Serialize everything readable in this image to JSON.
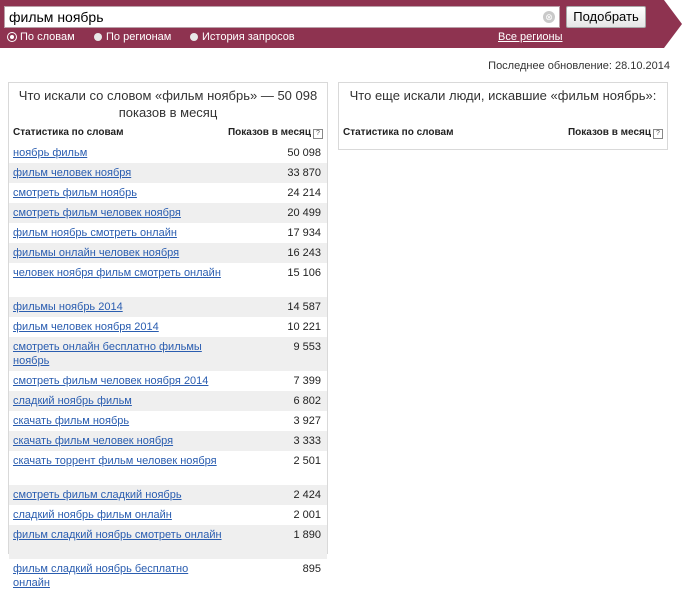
{
  "search": {
    "query": "фильм ноябрь",
    "clear_glyph": "⊗",
    "submit_label": "Подобрать"
  },
  "mode_tabs": [
    {
      "label": "По словам",
      "selected": true
    },
    {
      "label": "По регионам",
      "selected": false
    },
    {
      "label": "История запросов",
      "selected": false
    }
  ],
  "all_regions_label": "Все регионы",
  "last_update": "Последнее обновление: 28.10.2014",
  "left_panel": {
    "title": "Что искали со словом «фильм ноябрь» — 50 098 показов в месяц",
    "col_words": "Статистика по словам",
    "col_shows": "Показов в месяц",
    "help_glyph": "?",
    "rows": [
      {
        "q": "ноябрь фильм",
        "n": "50 098"
      },
      {
        "q": "фильм человек ноября",
        "n": "33 870"
      },
      {
        "q": "смотреть фильм ноябрь",
        "n": "24 214"
      },
      {
        "q": "смотреть фильм человек ноября",
        "n": "20 499"
      },
      {
        "q": "фильм ноябрь смотреть онлайн",
        "n": "17 934"
      },
      {
        "q": "фильмы онлайн человек ноября",
        "n": "16 243"
      },
      {
        "q": "человек ноября фильм смотреть онлайн",
        "n": "15 106"
      },
      {
        "q": "фильмы ноябрь 2014",
        "n": "14 587"
      },
      {
        "q": "фильм человек ноября 2014",
        "n": "10 221"
      },
      {
        "q": "смотреть онлайн бесплатно фильмы ноябрь",
        "n": "9 553"
      },
      {
        "q": "смотреть фильм человек ноября 2014",
        "n": "7 399"
      },
      {
        "q": "сладкий ноябрь фильм",
        "n": "6 802"
      },
      {
        "q": "скачать фильм ноябрь",
        "n": "3 927"
      },
      {
        "q": "скачать фильм человек ноября",
        "n": "3 333"
      },
      {
        "q": "скачать торрент фильм человек ноября",
        "n": "2 501"
      },
      {
        "q": "смотреть фильм сладкий ноябрь",
        "n": "2 424"
      },
      {
        "q": "сладкий ноябрь фильм онлайн",
        "n": "2 001"
      },
      {
        "q": "фильм сладкий ноябрь смотреть онлайн",
        "n": "1 890"
      },
      {
        "q": "фильм сладкий ноябрь бесплатно онлайн",
        "n": "895"
      }
    ]
  },
  "right_panel": {
    "title": "Что еще искали люди, искавшие «фильм ноябрь»:",
    "col_words": "Статистика по словам",
    "col_shows": "Показов в месяц",
    "help_glyph": "?"
  }
}
